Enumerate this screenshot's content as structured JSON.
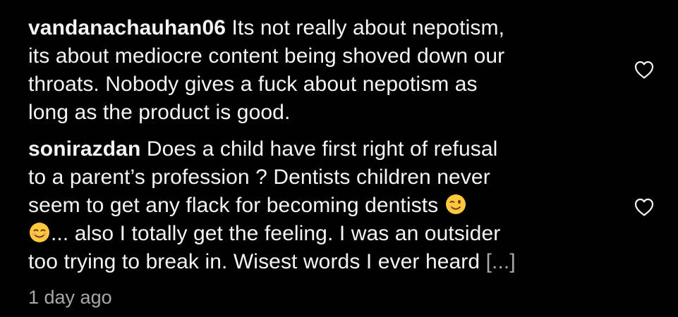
{
  "comments": [
    {
      "username": "vandanachauhan06",
      "lines": [
        "Its not really about nepotism,",
        "its about mediocre content being shoved down our",
        "throats. Nobody gives a fuck about nepotism as",
        "long as the product is good."
      ]
    },
    {
      "username": "sonirazdan",
      "lines": [
        "Does a child have first right of refusal",
        "to a parent’s profession ? Dentists children never",
        "seem to get any flack for becoming dentists ",
        "... also I totally get the feeling. I was an outsider",
        "too trying to break in. Wisest words I ever heard "
      ],
      "more_label": "[...]",
      "time_ago": "1 day ago"
    }
  ],
  "icons": {
    "like": "heart-outline-icon",
    "emoji_wink": "winking-face-emoji",
    "emoji_blush": "smiling-face-emoji"
  },
  "colors": {
    "background": "#000000",
    "text": "#f5f5f5",
    "secondary": "#a8a8a8",
    "emoji_yellow": "#ffc83d"
  }
}
